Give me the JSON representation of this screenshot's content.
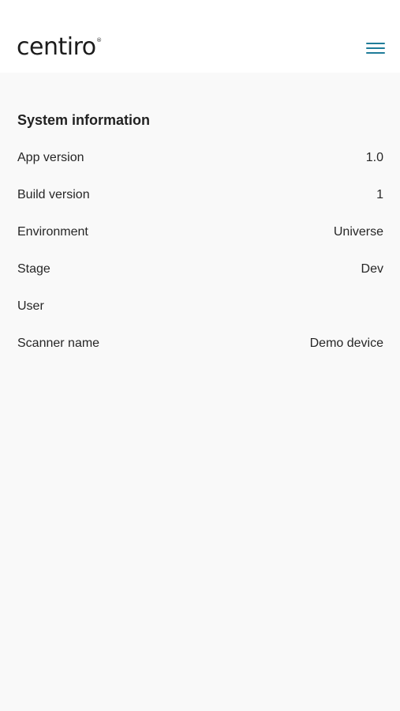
{
  "header": {
    "logo_text": "centiro",
    "logo_mark": "®",
    "menu_icon": "hamburger-menu-icon"
  },
  "colors": {
    "accent": "#1f7c99",
    "header_bg": "#ffffff",
    "page_bg": "#f9f9f9",
    "text": "#222222"
  },
  "main": {
    "section_title": "System information",
    "rows": [
      {
        "label": "App version",
        "value": "1.0"
      },
      {
        "label": "Build version",
        "value": "1"
      },
      {
        "label": "Environment",
        "value": "Universe"
      },
      {
        "label": "Stage",
        "value": "Dev"
      },
      {
        "label": "User",
        "value": ""
      },
      {
        "label": "Scanner name",
        "value": "Demo device"
      }
    ]
  }
}
